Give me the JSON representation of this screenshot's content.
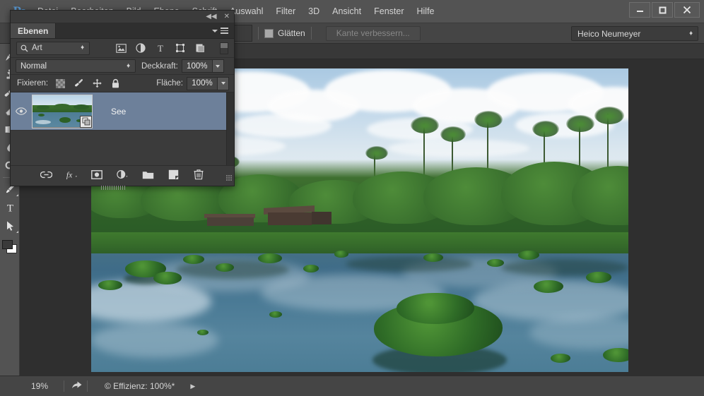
{
  "app": {
    "logo": "Ps",
    "window_controls": {
      "minimize": "minimize-button",
      "maximize": "maximize-button",
      "close": "close-button"
    }
  },
  "menubar": {
    "items": [
      {
        "label": "Datei"
      },
      {
        "label": "Bearbeiten"
      },
      {
        "label": "Bild"
      },
      {
        "label": "Ebene"
      },
      {
        "label": "Schrift"
      },
      {
        "label": "Auswahl"
      },
      {
        "label": "Filter"
      },
      {
        "label": "3D"
      },
      {
        "label": "Ansicht"
      },
      {
        "label": "Fenster"
      },
      {
        "label": "Hilfe"
      }
    ]
  },
  "options_bar": {
    "smooth_label": "Glätten",
    "smooth_checked": false,
    "refine_edge_label": "Kante verbessern...",
    "refine_edge_enabled": false,
    "workspace": "Heico Neumeyer"
  },
  "document_tab": {
    "modified_marker": "*",
    "close_glyph": "✕"
  },
  "toolbar": {
    "tools": [
      {
        "name": "brush-tool"
      },
      {
        "name": "clone-stamp-tool"
      },
      {
        "name": "history-brush-tool"
      },
      {
        "name": "eraser-tool"
      },
      {
        "name": "gradient-tool"
      },
      {
        "name": "blur-tool"
      },
      {
        "name": "dodge-tool"
      },
      {
        "name": "pen-tool"
      },
      {
        "name": "type-tool"
      },
      {
        "name": "path-selection-tool"
      }
    ],
    "foreground_color": "#3a3a3a",
    "background_color": "#ffffff"
  },
  "layers_panel": {
    "tab_label": "Ebenen",
    "collapse_glyph": "◀◀",
    "close_glyph": "✕",
    "filter": {
      "type_label": "Art",
      "icons": [
        "pixel-layer-filter-icon",
        "adjustment-layer-filter-icon",
        "type-layer-filter-icon",
        "shape-layer-filter-icon",
        "smart-object-filter-icon"
      ]
    },
    "blend_mode": "Normal",
    "opacity_label": "Deckkraft:",
    "opacity_value": "100%",
    "lock_label": "Fixieren:",
    "locks": [
      "lock-transparency-icon",
      "lock-image-pixels-icon",
      "lock-position-icon",
      "lock-all-icon"
    ],
    "fill_label": "Fläche:",
    "fill_value": "100%",
    "layers": [
      {
        "name": "See",
        "visible": true,
        "selected": true,
        "kind": "smart-object"
      }
    ],
    "footer_icons": [
      "link-layers-icon",
      "layer-style-fx-icon",
      "add-layer-mask-icon",
      "new-adjustment-layer-icon",
      "new-group-icon",
      "new-layer-icon",
      "delete-layer-icon"
    ]
  },
  "status_bar": {
    "zoom": "19%",
    "share_icon": "share-icon",
    "efficiency": "© Effizienz: 100%*",
    "expand_glyph": "▶"
  },
  "canvas": {
    "image_title": "tropical-lake-photo",
    "description": "Tropischer See mit Wasserhyazinthen, Palmen und Hütten"
  }
}
